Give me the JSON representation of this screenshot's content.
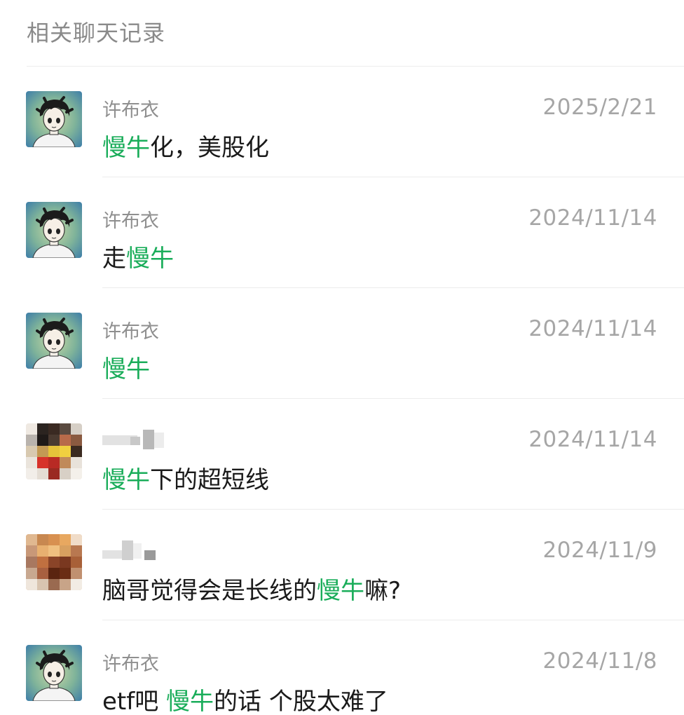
{
  "header": {
    "title": "相关聊天记录"
  },
  "theme": {
    "highlight_color": "#1aad5a",
    "date_color": "#a6a6a6",
    "sender_color": "#8f8f8f"
  },
  "records": [
    {
      "sender": "许布衣",
      "date": "2025/2/21",
      "avatar": "cartoon-avatar-icon",
      "msg": {
        "before": "",
        "keyword": "慢牛",
        "after": "化，美股化"
      }
    },
    {
      "sender": "许布衣",
      "date": "2024/11/14",
      "avatar": "cartoon-avatar-icon",
      "msg": {
        "before": "走",
        "keyword": "慢牛",
        "after": ""
      }
    },
    {
      "sender": "许布衣",
      "date": "2024/11/14",
      "avatar": "cartoon-avatar-icon",
      "msg": {
        "before": "",
        "keyword": "慢牛",
        "after": ""
      }
    },
    {
      "sender": "",
      "date": "2024/11/14",
      "avatar": "pixelated-avatar-icon",
      "msg": {
        "before": "",
        "keyword": "慢牛",
        "after": "下的超短线"
      }
    },
    {
      "sender": "",
      "date": "2024/11/9",
      "avatar": "pixelated-avatar-icon",
      "msg": {
        "before": "脑哥觉得会是长线的",
        "keyword": "慢牛",
        "after": "嘛?"
      }
    },
    {
      "sender": "许布衣",
      "date": "2024/11/8",
      "avatar": "cartoon-avatar-icon",
      "msg": {
        "before": "etf吧 ",
        "keyword": "慢牛",
        "after": "的话 个股太难了"
      }
    }
  ]
}
